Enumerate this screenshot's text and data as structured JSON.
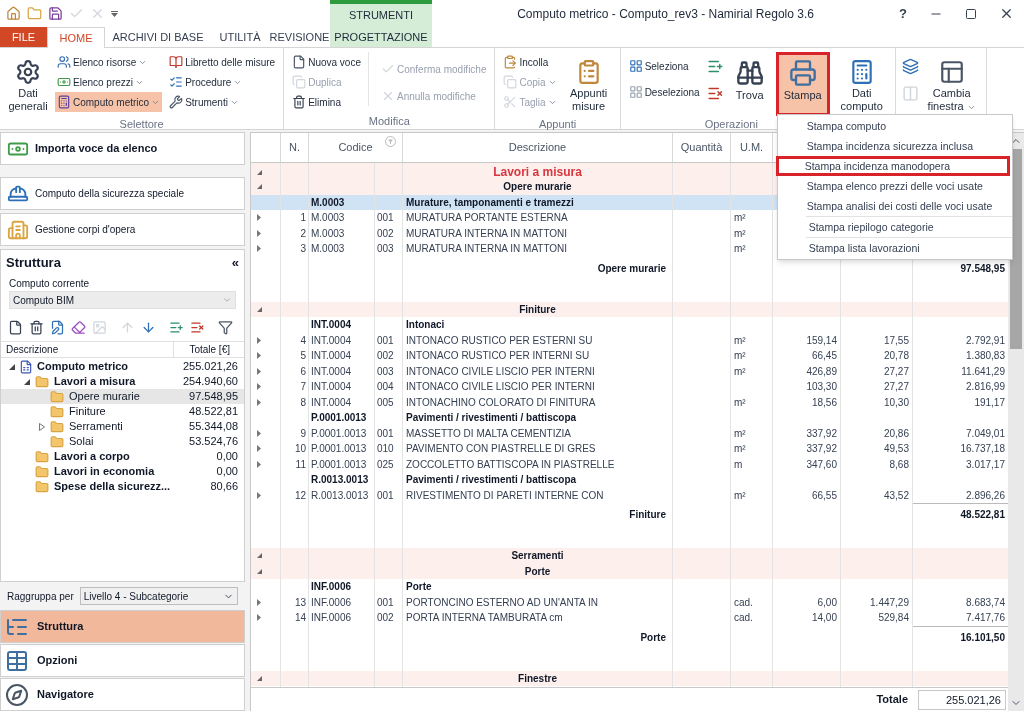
{
  "window": {
    "title": "Computo metrico - Computo_rev3 - Namirial Regolo 3.6",
    "help": "?"
  },
  "quick_access": [
    {
      "disabled": false
    },
    {
      "disabled": false
    },
    {
      "disabled": false
    },
    {
      "disabled": true
    },
    {
      "disabled": true
    }
  ],
  "context_group": "STRUMENTI",
  "tabs": [
    {
      "label": "FILE",
      "kind": "file",
      "selected": false
    },
    {
      "label": "HOME",
      "kind": "tab",
      "selected": true
    },
    {
      "label": "ARCHIVI DI BASE",
      "kind": "tab",
      "selected": false
    },
    {
      "label": "UTILITÀ",
      "kind": "tab",
      "selected": false
    },
    {
      "label": "REVISIONE",
      "kind": "tab",
      "selected": false
    },
    {
      "label": "PROGETTAZIONE",
      "kind": "context",
      "selected": false
    }
  ],
  "ribbon": {
    "selettore": {
      "label": "Selettore",
      "large": {
        "label": "Dati generali"
      },
      "items": [
        {
          "label": "Elenco risorse",
          "dropdown": true,
          "selected": false
        },
        {
          "label": "Elenco prezzi",
          "dropdown": true,
          "selected": false
        },
        {
          "label": "Computo metrico",
          "dropdown": true,
          "selected": true
        },
        {
          "label": "Libretto delle misure",
          "dropdown": false,
          "selected": false
        },
        {
          "label": "Procedure",
          "dropdown": true,
          "selected": false
        },
        {
          "label": "Strumenti",
          "dropdown": true,
          "selected": false
        }
      ]
    },
    "modifica": {
      "label": "Modifica",
      "items": [
        {
          "label": "Nuova voce",
          "disabled": false
        },
        {
          "label": "Duplica",
          "disabled": true
        },
        {
          "label": "Elimina",
          "disabled": false
        },
        {
          "label": "Conferma modifiche",
          "disabled": true
        },
        {
          "label": "Annulla modifiche",
          "disabled": true
        }
      ]
    },
    "appunti": {
      "label": "Appunti",
      "items": [
        {
          "label": "Incolla",
          "disabled": false,
          "dropdown": false
        },
        {
          "label": "Copia",
          "disabled": true,
          "dropdown": true
        },
        {
          "label": "Taglia",
          "disabled": true,
          "dropdown": true
        }
      ],
      "large": {
        "label": "Appunti misure"
      }
    },
    "operazioni": {
      "label": "Operazioni",
      "items": [
        {
          "label": "Seleziona"
        },
        {
          "label": "Deseleziona"
        }
      ],
      "large": [
        {
          "label": "Trova",
          "highlighted": false
        },
        {
          "label": "Stampa",
          "highlighted": true
        },
        {
          "label": "Dati computo",
          "highlighted": false
        }
      ]
    },
    "finestra": {
      "tools": [
        {
          "disabled": false
        },
        {
          "disabled": true
        }
      ],
      "large": {
        "label": "Cambia finestra",
        "dropdown": true
      }
    }
  },
  "print_menu": {
    "sections": [
      [
        {
          "label": "Stampa computo",
          "highlighted": false
        },
        {
          "label": "Stampa incidenza sicurezza inclusa",
          "highlighted": false
        },
        {
          "label": "Stampa incidenza manodopera",
          "highlighted": true
        },
        {
          "label": "Stampa elenco prezzi delle voci usate",
          "highlighted": false
        },
        {
          "label": "Stampa analisi dei costi delle voci usate",
          "highlighted": false
        }
      ],
      [
        {
          "label": "Stampa riepilogo categorie",
          "highlighted": false
        }
      ],
      [
        {
          "label": "Stampa lista lavorazioni",
          "highlighted": false
        }
      ]
    ]
  },
  "actions": [
    {
      "label": "Importa voce da elenco",
      "kind": "primary"
    },
    {
      "label": "Computo della sicurezza speciale",
      "kind": "secondary"
    },
    {
      "label": "Gestione corpi d'opera",
      "kind": "secondary"
    }
  ],
  "structure": {
    "title": "Struttura",
    "collapse": "«",
    "current_label": "Computo corrente",
    "current_value": "Computo BIM",
    "toolbar": [
      {
        "disabled": false
      },
      {
        "disabled": false
      },
      {
        "disabled": false
      },
      {
        "disabled": false
      },
      {
        "disabled": true
      },
      {
        "disabled": true
      },
      {
        "disabled": false
      },
      {
        "disabled": false
      },
      {
        "disabled": false
      },
      {
        "disabled": false
      }
    ],
    "columns": [
      "Descrizione",
      "Totale [€]"
    ],
    "tree": [
      {
        "label": "Computo metrico",
        "total": "255.021,26",
        "expanded": true,
        "selected": false,
        "children": [
          {
            "label": "Lavori a misura",
            "total": "254.940,60",
            "expanded": true,
            "selected": false,
            "children": [
              {
                "label": "Opere murarie",
                "total": "97.548,95",
                "selected": true
              },
              {
                "label": "Finiture",
                "total": "48.522,81",
                "selected": false
              },
              {
                "label": "Serramenti",
                "total": "55.344,08",
                "expanded": false,
                "selected": false
              },
              {
                "label": "Solai",
                "total": "53.524,76",
                "selected": false
              }
            ]
          },
          {
            "label": "Lavori a corpo",
            "total": "0,00",
            "selected": false
          },
          {
            "label": "Lavori in economia",
            "total": "0,00",
            "selected": false
          },
          {
            "label": "Spese della sicurezz...",
            "total": "80,66",
            "selected": false
          }
        ]
      }
    ],
    "group_by_label": "Raggruppa per",
    "group_by_value": "Livello 4 - Subcategorie"
  },
  "nav": [
    {
      "label": "Struttura",
      "selected": true
    },
    {
      "label": "Opzioni",
      "selected": false
    },
    {
      "label": "Navigatore",
      "selected": false
    }
  ],
  "table": {
    "columns": [
      "N.",
      "Codice",
      "Descrizione",
      "Quantità",
      "U.M."
    ],
    "rows": [
      {
        "kind": "chapter",
        "label": "Lavori a misura",
        "expanded": true
      },
      {
        "kind": "group",
        "label": "Opere murarie",
        "expanded": true
      },
      {
        "kind": "header",
        "code": "M.0003",
        "desc": "Murature, tamponamenti e tramezzi",
        "selected": true
      },
      {
        "kind": "item",
        "n": "1",
        "code": "M.0003",
        "sub": "001",
        "desc": "MURATURA PORTANTE ESTERNA",
        "um": "m²",
        "expanded": false,
        "selected": false
      },
      {
        "kind": "item",
        "n": "2",
        "code": "M.0003",
        "sub": "002",
        "desc": "MURATURA INTERNA IN MATTONI",
        "um": "m²",
        "expanded": false,
        "selected": false
      },
      {
        "kind": "item",
        "n": "3",
        "code": "M.0003",
        "sub": "003",
        "desc": "MURATURA INTERNA IN MATTONI",
        "um": "m²",
        "expanded": false,
        "selected": false
      },
      {
        "kind": "subtotal",
        "label": "Opere murarie",
        "column_9": "97.548,95"
      },
      {
        "kind": "spacer"
      },
      {
        "kind": "group",
        "label": "Finiture",
        "expanded": true
      },
      {
        "kind": "header",
        "code": "INT.0004",
        "desc": "Intonaci",
        "selected": false
      },
      {
        "kind": "item",
        "n": "4",
        "code": "INT.0004",
        "sub": "001",
        "desc": "INTONACO RUSTICO PER ESTERNI SU",
        "um": "m²",
        "column_7": "159,14",
        "column_8": "17,55",
        "column_9": "2.792,91",
        "expanded": false,
        "selected": false
      },
      {
        "kind": "item",
        "n": "5",
        "code": "INT.0004",
        "sub": "002",
        "desc": "INTONACO RUSTICO PER INTERNI SU",
        "um": "m²",
        "column_7": "66,45",
        "column_8": "20,78",
        "column_9": "1.380,83",
        "expanded": false,
        "selected": false
      },
      {
        "kind": "item",
        "n": "6",
        "code": "INT.0004",
        "sub": "003",
        "desc": "INTONACO CIVILE LISCIO PER INTERNI",
        "um": "m²",
        "column_7": "426,89",
        "column_8": "27,27",
        "column_9": "11.641,29",
        "expanded": false,
        "selected": false
      },
      {
        "kind": "item",
        "n": "7",
        "code": "INT.0004",
        "sub": "004",
        "desc": "INTONACO CIVILE LISCIO PER INTERNI",
        "column_7": "103,30",
        "column_8": "27,27",
        "column_9": "2.816,99",
        "expanded": false,
        "selected": false
      },
      {
        "kind": "item",
        "n": "8",
        "code": "INT.0004",
        "sub": "005",
        "desc": "INTONACHINO COLORATO DI FINITURA",
        "um": "m²",
        "column_7": "18,56",
        "column_8": "10,30",
        "column_9": "191,17",
        "expanded": false,
        "selected": false
      },
      {
        "kind": "header",
        "code": "P.0001.0013",
        "desc": "Pavimenti / rivestimenti / battiscopa",
        "selected": false
      },
      {
        "kind": "item",
        "n": "9",
        "code": "P.0001.0013",
        "sub": "001",
        "desc": "MASSETTO DI MALTA CEMENTIZIA",
        "um": "m²",
        "column_7": "337,92",
        "column_8": "20,86",
        "column_9": "7.049,01",
        "expanded": false,
        "selected": false
      },
      {
        "kind": "item",
        "n": "10",
        "code": "P.0001.0013",
        "sub": "010",
        "desc": "PAVIMENTO CON PIASTRELLE DI GRES",
        "um": "m²",
        "column_7": "337,92",
        "column_8": "49,53",
        "column_9": "16.737,18",
        "expanded": false,
        "selected": false
      },
      {
        "kind": "item",
        "n": "11",
        "code": "P.0001.0013",
        "sub": "025",
        "desc": "ZOCCOLETTO BATTISCOPA IN PIASTRELLE",
        "um": "m",
        "column_7": "347,60",
        "column_8": "8,68",
        "column_9": "3.017,17",
        "expanded": false,
        "selected": false
      },
      {
        "kind": "header",
        "code": "R.0013.0013",
        "desc": "Pavimenti / rivestimenti / battiscopa",
        "selected": false
      },
      {
        "kind": "item",
        "n": "12",
        "code": "R.0013.0013",
        "sub": "001",
        "desc": "RIVESTIMENTO DI PARETI INTERNE CON",
        "um": "m²",
        "column_7": "66,55",
        "column_8": "43,52",
        "column_9": "2.896,26",
        "expanded": false,
        "selected": false
      },
      {
        "kind": "subtotal",
        "label": "Finiture",
        "column_9": "48.522,81"
      },
      {
        "kind": "spacer"
      },
      {
        "kind": "group",
        "label": "Serramenti",
        "expanded": true
      },
      {
        "kind": "group",
        "label": "Porte",
        "expanded": true
      },
      {
        "kind": "header",
        "code": "INF.0006",
        "desc": "Porte",
        "selected": false
      },
      {
        "kind": "item",
        "n": "13",
        "code": "INF.0006",
        "sub": "001",
        "desc": "PORTONCINO ESTERNO AD UN'ANTA IN",
        "um": "cad.",
        "column_7": "6,00",
        "column_8": "1.447,29",
        "column_9": "8.683,74",
        "expanded": false,
        "selected": false
      },
      {
        "kind": "item",
        "n": "14",
        "code": "INF.0006",
        "sub": "002",
        "desc": "PORTA INTERNA TAMBURATA cm",
        "um": "cad.",
        "column_7": "14,00",
        "column_8": "529,84",
        "column_9": "7.417,76",
        "expanded": false,
        "selected": false
      },
      {
        "kind": "subtotal",
        "label": "Porte",
        "column_9": "16.101,50"
      },
      {
        "kind": "spacer"
      },
      {
        "kind": "group",
        "label": "Finestre",
        "expanded": true
      }
    ],
    "total": {
      "label": "Totale",
      "value": "255.021,26"
    }
  }
}
